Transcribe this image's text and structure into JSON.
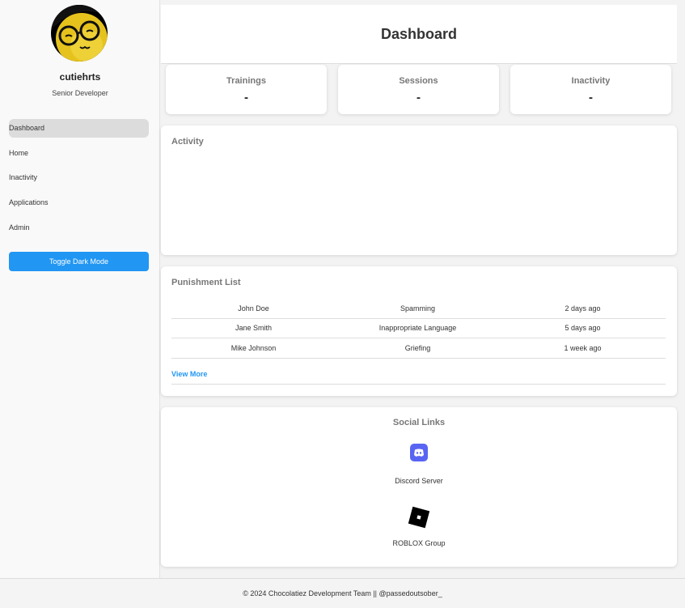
{
  "profile": {
    "username": "cutiehrts",
    "role": "Senior Developer"
  },
  "sidebar": {
    "items": [
      {
        "label": "Dashboard",
        "active": true
      },
      {
        "label": "Home"
      },
      {
        "label": "Inactivity"
      },
      {
        "label": "Applications"
      },
      {
        "label": "Admin"
      }
    ],
    "toggle_label": "Toggle Dark Mode"
  },
  "header": {
    "title": "Dashboard"
  },
  "stats": [
    {
      "label": "Trainings",
      "value": "-"
    },
    {
      "label": "Sessions",
      "value": "-"
    },
    {
      "label": "Inactivity",
      "value": "-"
    }
  ],
  "activity": {
    "title": "Activity"
  },
  "punishments": {
    "title": "Punishment List",
    "rows": [
      {
        "name": "John Doe",
        "reason": "Spamming",
        "time": "2 days ago"
      },
      {
        "name": "Jane Smith",
        "reason": "Inappropriate Language",
        "time": "5 days ago"
      },
      {
        "name": "Mike Johnson",
        "reason": "Griefing",
        "time": "1 week ago"
      }
    ],
    "view_more": "View More"
  },
  "social": {
    "title": "Social Links",
    "links": [
      {
        "label": "Discord Server",
        "icon": "discord-icon"
      },
      {
        "label": "ROBLOX Group",
        "icon": "roblox-icon"
      }
    ]
  },
  "footer": {
    "text": "© 2024 Chocolatiez Development Team || @passedoutsober_"
  },
  "colors": {
    "accent": "#2196f3",
    "discord": "#5865f2"
  }
}
